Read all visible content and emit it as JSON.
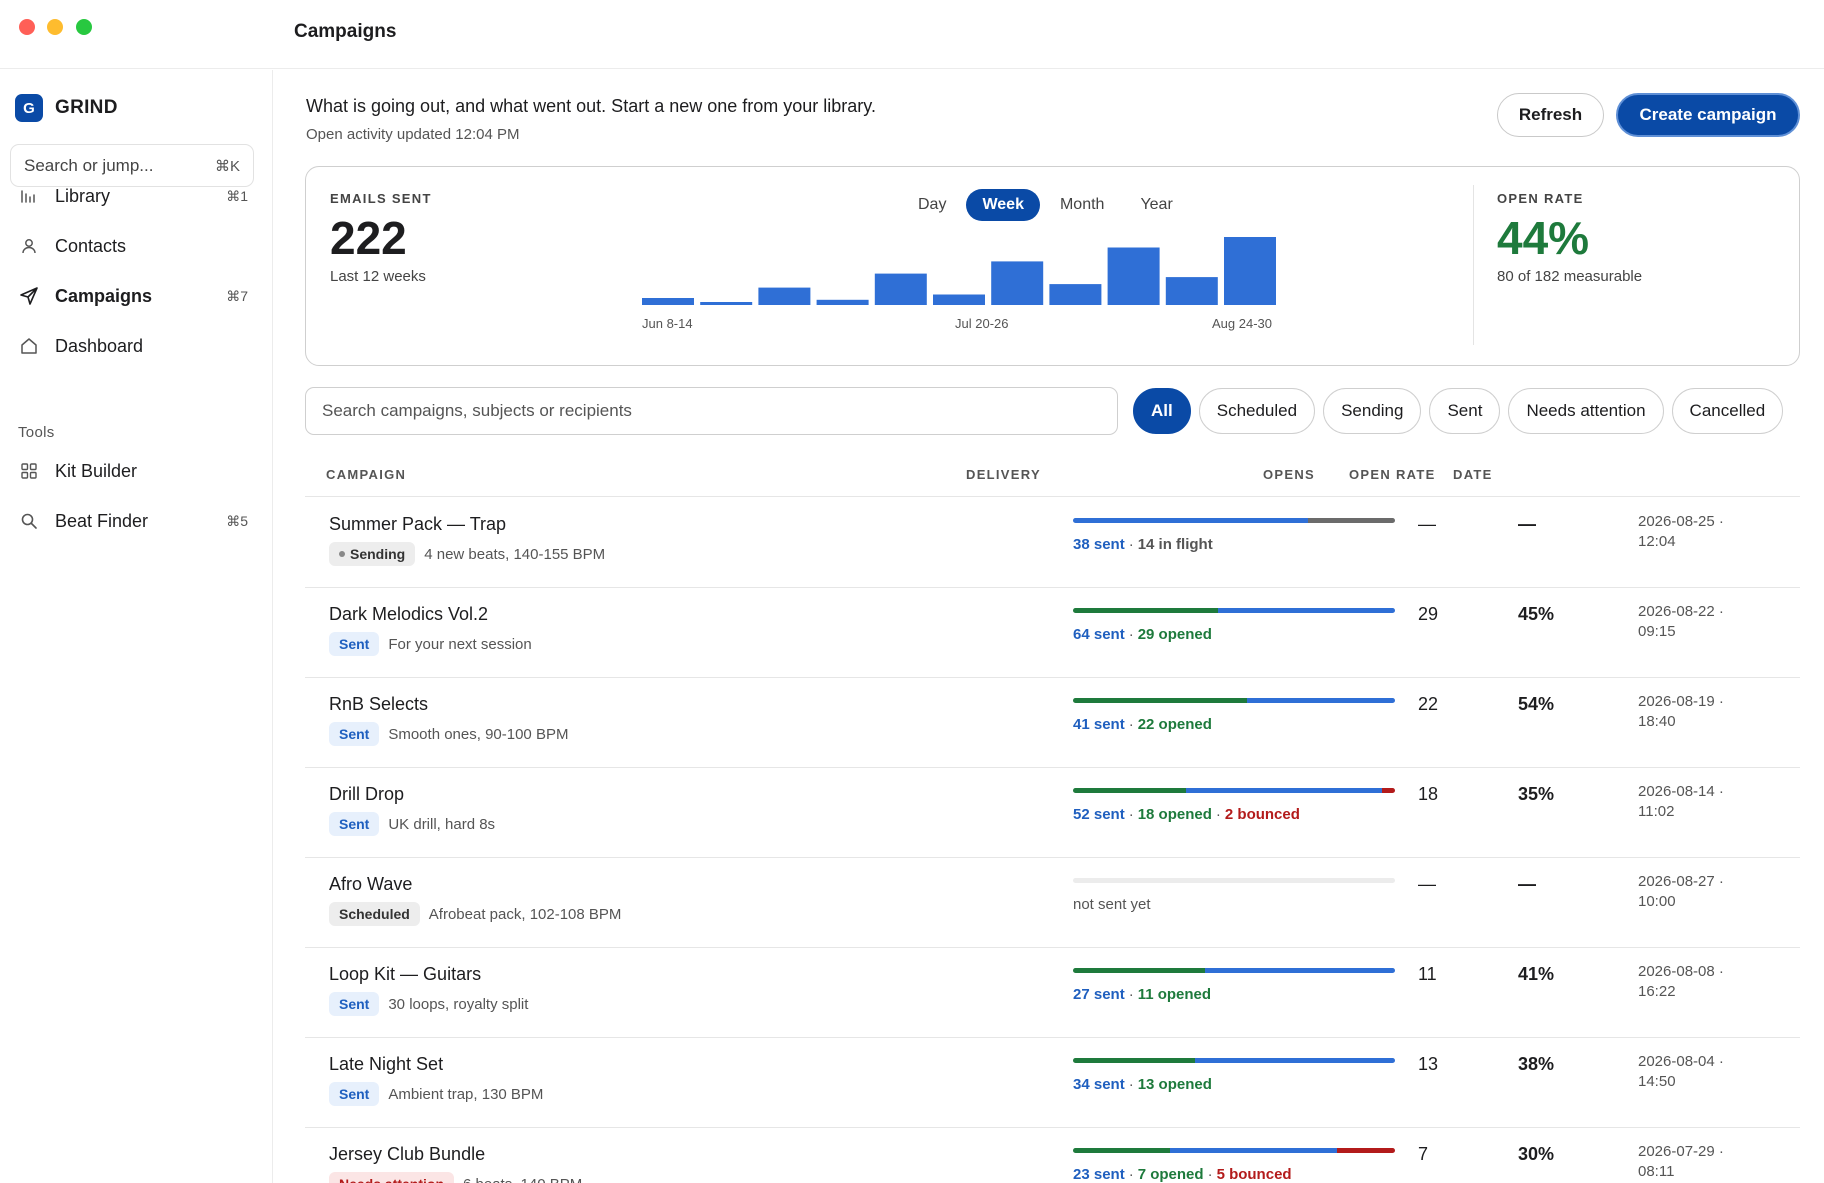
{
  "window": {
    "title": "Campaigns"
  },
  "sidebar": {
    "brand": {
      "logo_letter": "G",
      "name": "GRIND"
    },
    "search": {
      "placeholder": "Search or jump...",
      "shortcut": "⌘K"
    },
    "nav": [
      {
        "label": "Library",
        "icon": "library-icon",
        "shortcut": "⌘1"
      },
      {
        "label": "Contacts",
        "icon": "contact-icon",
        "shortcut": ""
      },
      {
        "label": "Campaigns",
        "icon": "send-icon",
        "shortcut": "⌘7",
        "active": true
      },
      {
        "label": "Dashboard",
        "icon": "home-icon",
        "shortcut": ""
      }
    ],
    "tools_label": "Tools",
    "tools": [
      {
        "label": "Kit Builder",
        "icon": "grid-icon",
        "shortcut": ""
      },
      {
        "label": "Beat Finder",
        "icon": "search-icon",
        "shortcut": "⌘5"
      }
    ]
  },
  "header": {
    "intro": "What is going out, and what went out. Start a new one from your library.",
    "updated": "Open activity updated 12:04 PM",
    "refresh_label": "Refresh",
    "create_label": "Create campaign"
  },
  "stats": {
    "emails_sent_label": "EMAILS SENT",
    "emails_sent_value": "222",
    "emails_sent_sub": "Last 12 weeks",
    "range_tabs": [
      "Day",
      "Week",
      "Month",
      "Year"
    ],
    "active_range": "Week",
    "open_rate_label": "OPEN RATE",
    "open_rate_value": "44%",
    "open_rate_sub": "80 of 182 measurable",
    "open_rate_color": "#1e7a3c"
  },
  "chart_data": {
    "type": "bar",
    "values": [
      4,
      1,
      10,
      3,
      18,
      6,
      25,
      12,
      33,
      16,
      39,
      22
    ],
    "tick_labels": [
      "Jun 8-14",
      "Jul 20-26",
      "Aug 24-30"
    ],
    "bar_color": "#2f6fd6"
  },
  "filters": {
    "search_placeholder": "Search campaigns, subjects or recipients",
    "chips": [
      "All",
      "Scheduled",
      "Sending",
      "Sent",
      "Needs attention",
      "Cancelled"
    ],
    "active": "All"
  },
  "table": {
    "headers": {
      "campaign": "CAMPAIGN",
      "delivery": "DELIVERY",
      "opens": "OPENS",
      "open_rate": "OPEN RATE",
      "date": "DATE"
    },
    "rows": [
      {
        "name": "Summer Pack — Trap",
        "status": "Sending",
        "subtitle": "4 new beats, 140-155 BPM",
        "bar": {
          "opened": 0,
          "sent": 0.73,
          "flight": 0.27,
          "bounced": 0
        },
        "delivery": [
          {
            "text": "38 sent",
            "kind": "sent"
          },
          {
            "text": "14 in flight",
            "kind": "flight"
          }
        ],
        "opens": "—",
        "rate": "—",
        "date": "2026-08-25 ·",
        "time": "12:04"
      },
      {
        "name": "Dark Melodics Vol.2",
        "status": "Sent",
        "subtitle": "For your next session",
        "bar": {
          "opened": 0.45,
          "sent": 0.55,
          "flight": 0,
          "bounced": 0
        },
        "delivery": [
          {
            "text": "64 sent",
            "kind": "sent"
          },
          {
            "text": "29 opened",
            "kind": "opened"
          }
        ],
        "opens": "29",
        "rate": "45%",
        "date": "2026-08-22 ·",
        "time": "09:15"
      },
      {
        "name": "RnB Selects",
        "status": "Sent",
        "subtitle": "Smooth ones, 90-100 BPM",
        "bar": {
          "opened": 0.54,
          "sent": 0.46,
          "flight": 0,
          "bounced": 0
        },
        "delivery": [
          {
            "text": "41 sent",
            "kind": "sent"
          },
          {
            "text": "22 opened",
            "kind": "opened"
          }
        ],
        "opens": "22",
        "rate": "54%",
        "date": "2026-08-19 ·",
        "time": "18:40"
      },
      {
        "name": "Drill Drop",
        "status": "Sent",
        "subtitle": "UK drill, hard 8s",
        "bar": {
          "opened": 0.35,
          "sent": 0.61,
          "flight": 0,
          "bounced": 0.04
        },
        "delivery": [
          {
            "text": "52 sent",
            "kind": "sent"
          },
          {
            "text": "18 opened",
            "kind": "opened"
          },
          {
            "text": "2 bounced",
            "kind": "bounced"
          }
        ],
        "opens": "18",
        "rate": "35%",
        "date": "2026-08-14 ·",
        "time": "11:02"
      },
      {
        "name": "Afro Wave",
        "status": "Scheduled",
        "subtitle": "Afrobeat pack, 102-108 BPM",
        "bar": {
          "opened": 0,
          "sent": 0,
          "flight": 0,
          "bounced": 0
        },
        "delivery": [
          {
            "text": "not sent yet",
            "kind": "none"
          }
        ],
        "opens": "—",
        "rate": "—",
        "date": "2026-08-27 ·",
        "time": "10:00"
      },
      {
        "name": "Loop Kit — Guitars",
        "status": "Sent",
        "subtitle": "30 loops, royalty split",
        "bar": {
          "opened": 0.41,
          "sent": 0.59,
          "flight": 0,
          "bounced": 0
        },
        "delivery": [
          {
            "text": "27 sent",
            "kind": "sent"
          },
          {
            "text": "11 opened",
            "kind": "opened"
          }
        ],
        "opens": "11",
        "rate": "41%",
        "date": "2026-08-08 ·",
        "time": "16:22"
      },
      {
        "name": "Late Night Set",
        "status": "Sent",
        "subtitle": "Ambient trap, 130 BPM",
        "bar": {
          "opened": 0.38,
          "sent": 0.62,
          "flight": 0,
          "bounced": 0
        },
        "delivery": [
          {
            "text": "34 sent",
            "kind": "sent"
          },
          {
            "text": "13 opened",
            "kind": "opened"
          }
        ],
        "opens": "13",
        "rate": "38%",
        "date": "2026-08-04 ·",
        "time": "14:50"
      },
      {
        "name": "Jersey Club Bundle",
        "status": "Needs attention",
        "subtitle": "6 beats, 140 BPM",
        "bar": {
          "opened": 0.3,
          "sent": 0.52,
          "flight": 0,
          "bounced": 0.18
        },
        "delivery": [
          {
            "text": "23 sent",
            "kind": "sent"
          },
          {
            "text": "7 opened",
            "kind": "opened"
          },
          {
            "text": "5 bounced",
            "kind": "bounced"
          }
        ],
        "opens": "7",
        "rate": "30%",
        "date": "2026-07-29 ·",
        "time": "08:11"
      }
    ]
  },
  "colors": {
    "accent": "#0a4aa6",
    "bar_sent": "#2f6fd6",
    "bar_opened": "#1e7a3c",
    "bar_flight": "#6b6b6b",
    "bar_bounced": "#b31b1b",
    "bar_empty": "#ececec"
  }
}
